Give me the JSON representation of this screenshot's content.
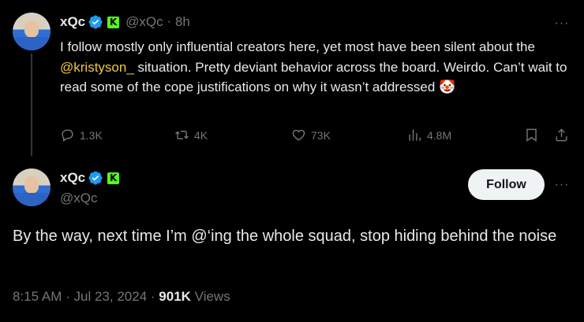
{
  "reply_tweet": {
    "name": "xQc",
    "handle": "@xQc",
    "separator": "·",
    "time": "8h",
    "text_parts": {
      "before": "I follow mostly only influential creators here, yet most have been silent about the ",
      "mention": "@kristyson_",
      "after": "  situation. Pretty deviant behavior across the board. Weirdo. Can’t wait to read some of the cope justifications on why it wasn’t addressed ",
      "emoji": "🤡"
    },
    "stats": {
      "replies": "1.3K",
      "reposts": "4K",
      "likes": "73K",
      "views": "4.8M"
    },
    "more_label": "···"
  },
  "main_tweet": {
    "name": "xQc",
    "handle": "@xQc",
    "follow_label": "Follow",
    "more_label": "···",
    "text": "By the way, next time I’m @‘ing the whole squad, stop hiding behind the noise",
    "time": "8:15 AM",
    "date": "Jul 23, 2024",
    "separator": "·",
    "views_count": "901K",
    "views_label": "Views"
  },
  "colors": {
    "background": "#000000",
    "text": "#e7e9ea",
    "muted": "#71767b",
    "verified": "#1d9bf0",
    "kick": "#53fc18",
    "mention": "#f0c93d"
  }
}
